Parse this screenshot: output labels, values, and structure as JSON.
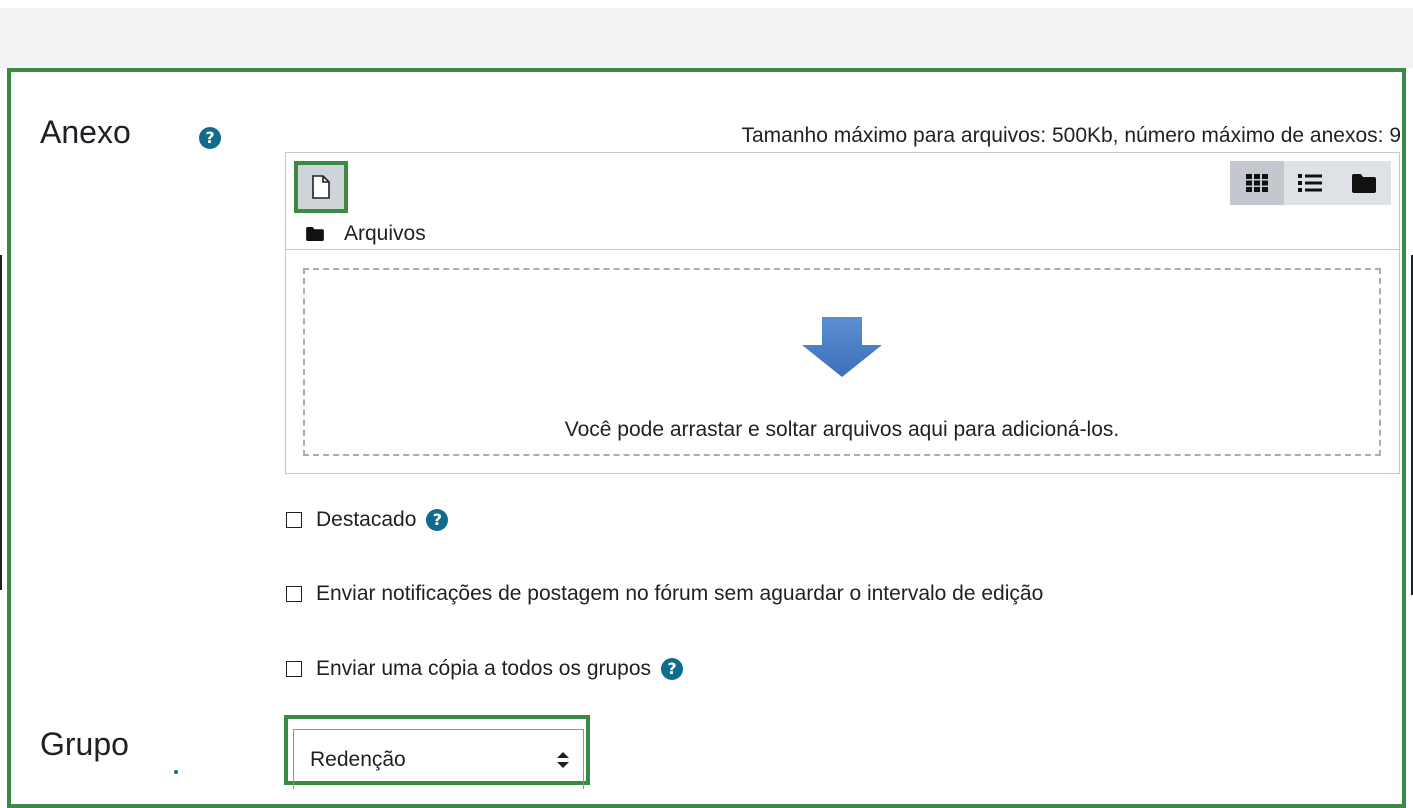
{
  "attachment": {
    "label": "Anexo",
    "help_icon": "question-circle-icon",
    "max_info": "Tamanho máximo para arquivos: 500Kb, número máximo de anexos: 9",
    "filemanager": {
      "add_file_icon": "file-icon",
      "views": [
        {
          "icon": "grid-icon",
          "active": true
        },
        {
          "icon": "list-icon",
          "active": false
        },
        {
          "icon": "folder-icon",
          "active": false
        }
      ],
      "path_icon": "folder-icon",
      "path_label": "Arquivos",
      "drop_icon": "down-arrow-icon",
      "drop_text": "Você pode arrastar e soltar arquivos aqui para adicioná-los."
    }
  },
  "options": [
    {
      "label": "Destacado",
      "checked": false,
      "has_help": true
    },
    {
      "label": "Enviar notificações de postagem no fórum sem aguardar o intervalo de edição",
      "checked": false,
      "has_help": false
    },
    {
      "label": "Enviar uma cópia a todos os grupos",
      "checked": false,
      "has_help": true
    }
  ],
  "group": {
    "label": "Grupo",
    "selected": "Redenção"
  },
  "colors": {
    "highlight": "#3b8a44",
    "help": "#0f6c8c",
    "arrow": "#4a7fc6"
  }
}
